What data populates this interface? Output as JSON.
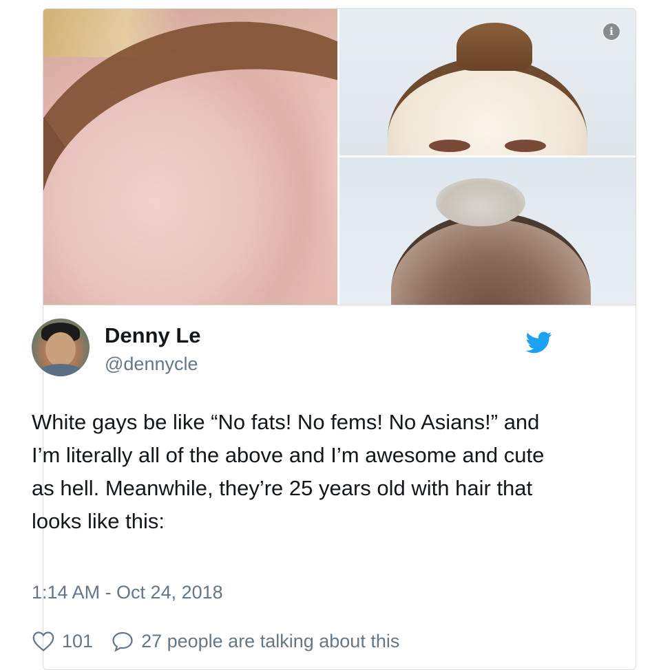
{
  "media": {
    "info_glyph": "i",
    "photos": [
      "forehead-closeup",
      "receding-hairline-light",
      "receding-hairline-dark"
    ]
  },
  "author": {
    "display_name": "Denny Le",
    "handle": "@dennycle",
    "avatar_icon": "avatar"
  },
  "brand": {
    "icon": "twitter-bird-icon",
    "color": "#1da1f2"
  },
  "tweet": {
    "text": "White gays be like “No fats! No fems! No Asians!” and I’m literally all of the above and I’m awesome and cute as hell. Meanwhile, they’re 25 years old with hair that looks like this:",
    "timestamp": "1:14 AM - Oct 24, 2018"
  },
  "actions": {
    "likes": "101",
    "conversation": "27 people are talking about this",
    "like_icon": "heart-icon",
    "reply_icon": "speech-bubble-icon"
  }
}
